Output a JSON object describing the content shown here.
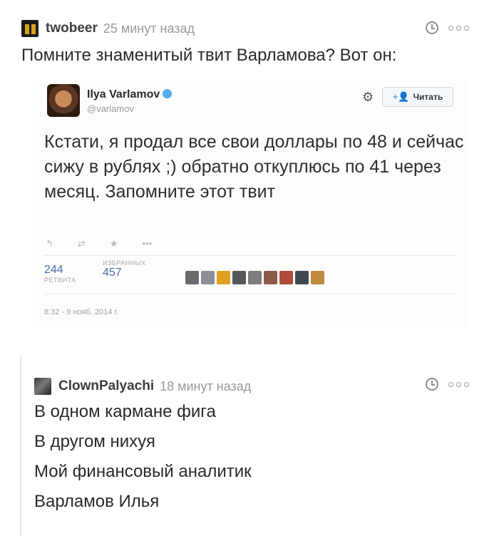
{
  "comments": [
    {
      "username": "twobeer",
      "time": "25 минут назад",
      "text": "Помните знаменитый твит Варламова? Вот он:"
    },
    {
      "username": "ClownPalyachi",
      "time": "18 минут назад",
      "lines": [
        "В одном кармане фига",
        "В другом нихуя",
        "Мой финансовый аналитик",
        "Варламов Илья"
      ]
    }
  ],
  "tweet": {
    "name": "Ilya Varlamov",
    "handle": "@varlamov",
    "follow_label": "Читать",
    "body": "Кстати, я продал все свои доллары по 48 и сейчас сижу в рублях ;) обратно откуплюсь по 41 через месяц. Запомните этот твит",
    "retweets": "244",
    "retweets_label": "РЕТВИТА",
    "favorites": "457",
    "favorites_label": "ИЗБРАННЫХ",
    "date": "8:32 - 9 нояб. 2014 г.",
    "action_icons": [
      "reply-icon",
      "retweet-icon",
      "favorite-icon",
      "more-icon"
    ],
    "favoriter_colors": [
      "#6b6b6b",
      "#8a8f96",
      "#e0a020",
      "#55595e",
      "#7d7d7d",
      "#8e5a4a",
      "#b04a3a",
      "#404850",
      "#c08a3e"
    ]
  },
  "colors": {
    "username": "#3d3d3d",
    "meta": "#9a9a9a",
    "tweet_link": "#4a6fa5",
    "verified": "#55acee"
  }
}
